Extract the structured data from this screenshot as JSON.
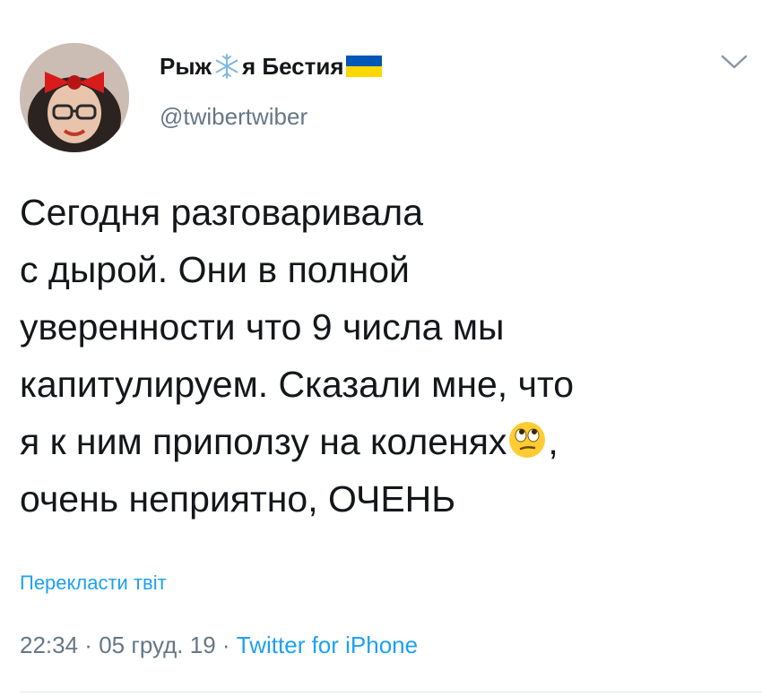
{
  "author": {
    "name_part1": "Рыж",
    "name_part2": "я Бестия",
    "handle": "@twibertwiber"
  },
  "tweet": {
    "lines": [
      "Сегодня разговаривала",
      "с дырой. Они в полной",
      "уверенности что 9 числа мы",
      "капитулируем. Сказали мне, что",
      "я к ним приползу на коленях",
      ",",
      "очень неприятно, ОЧЕНЬ"
    ]
  },
  "translate_label": "Перекласти твіт",
  "timestamp": {
    "time": "22:34",
    "sep1": " · ",
    "date": "05 груд. 19",
    "sep2": " · ",
    "source": "Twitter for iPhone"
  },
  "icons": {
    "snowflake": "snowflake-icon",
    "flag": "ukraine-flag-icon",
    "emoji": "face-with-rolling-eyes-emoji",
    "menu": "chevron-down-icon"
  },
  "colors": {
    "link": "#1da1f2",
    "secondary": "#657786",
    "text": "#14171a",
    "flag_blue": "#0057b7",
    "flag_yellow": "#ffd700"
  }
}
